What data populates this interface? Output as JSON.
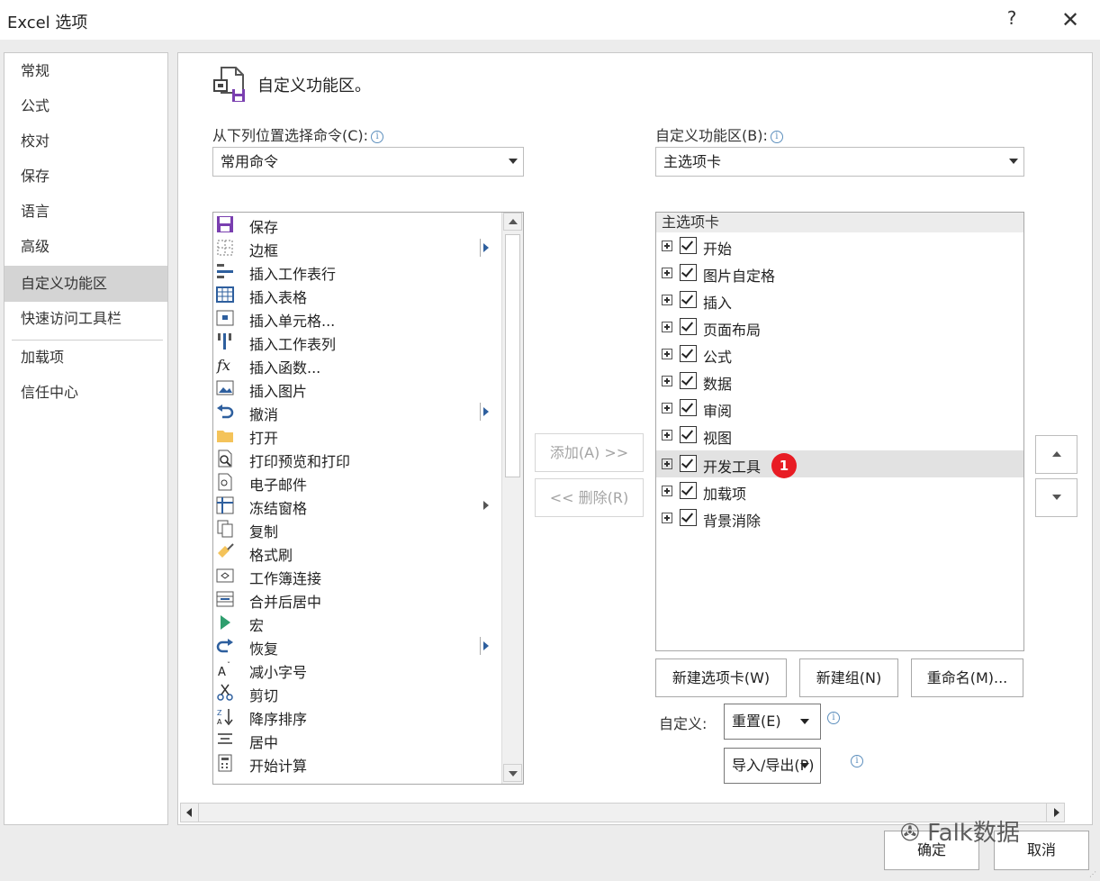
{
  "window": {
    "title": "Excel 选项",
    "help": "?",
    "close": "✕"
  },
  "nav": {
    "items": [
      {
        "label": "常规"
      },
      {
        "label": "公式"
      },
      {
        "label": "校对"
      },
      {
        "label": "保存"
      },
      {
        "label": "语言"
      },
      {
        "label": "高级"
      },
      {
        "label": "自定义功能区"
      },
      {
        "label": "快速访问工具栏"
      },
      {
        "label": "加载项"
      },
      {
        "label": "信任中心"
      }
    ],
    "selected": "自定义功能区"
  },
  "main": {
    "heading": "自定义功能区。",
    "choose_label": "从下列位置选择命令(C):",
    "choose_value": "常用命令",
    "customize_label": "自定义功能区(B):",
    "customize_value": "主选项卡",
    "commands": [
      {
        "label": "保存",
        "icon": "save-icon",
        "submenu": false
      },
      {
        "label": "边框",
        "icon": "border-icon",
        "submenu": true
      },
      {
        "label": "插入工作表行",
        "icon": "insert-rows-icon",
        "submenu": false
      },
      {
        "label": "插入表格",
        "icon": "insert-table-icon",
        "submenu": false
      },
      {
        "label": "插入单元格...",
        "icon": "insert-cells-icon",
        "submenu": false
      },
      {
        "label": "插入工作表列",
        "icon": "insert-columns-icon",
        "submenu": false
      },
      {
        "label": "插入函数...",
        "icon": "function-icon",
        "submenu": false
      },
      {
        "label": "插入图片",
        "icon": "picture-icon",
        "submenu": false
      },
      {
        "label": "撤消",
        "icon": "undo-icon",
        "submenu": true
      },
      {
        "label": "打开",
        "icon": "folder-icon",
        "submenu": false
      },
      {
        "label": "打印预览和打印",
        "icon": "print-preview-icon",
        "submenu": false
      },
      {
        "label": "电子邮件",
        "icon": "email-icon",
        "submenu": false
      },
      {
        "label": "冻结窗格",
        "icon": "freeze-panes-icon",
        "submenu": true
      },
      {
        "label": "复制",
        "icon": "copy-icon",
        "submenu": false
      },
      {
        "label": "格式刷",
        "icon": "format-painter-icon",
        "submenu": false
      },
      {
        "label": "工作簿连接",
        "icon": "connections-icon",
        "submenu": false
      },
      {
        "label": "合并后居中",
        "icon": "merge-center-icon",
        "submenu": false
      },
      {
        "label": "宏",
        "icon": "macro-icon",
        "submenu": false
      },
      {
        "label": "恢复",
        "icon": "redo-icon",
        "submenu": true
      },
      {
        "label": "减小字号",
        "icon": "decrease-font-icon",
        "submenu": false
      },
      {
        "label": "剪切",
        "icon": "scissors-icon",
        "submenu": false
      },
      {
        "label": "降序排序",
        "icon": "sort-desc-icon",
        "submenu": false
      },
      {
        "label": "居中",
        "icon": "align-center-icon",
        "submenu": false
      },
      {
        "label": "开始计算",
        "icon": "calculator-icon",
        "submenu": false
      }
    ],
    "add_button": "添加(A) >>",
    "remove_button": "<< 删除(R)",
    "tree_header": "主选项卡",
    "tabs": [
      {
        "label": "开始",
        "checked": true
      },
      {
        "label": "图片自定格",
        "checked": true
      },
      {
        "label": "插入",
        "checked": true
      },
      {
        "label": "页面布局",
        "checked": true
      },
      {
        "label": "公式",
        "checked": true
      },
      {
        "label": "数据",
        "checked": true
      },
      {
        "label": "审阅",
        "checked": true
      },
      {
        "label": "视图",
        "checked": true
      },
      {
        "label": "开发工具",
        "checked": true
      },
      {
        "label": "加载项",
        "checked": true
      },
      {
        "label": "背景消除",
        "checked": true
      }
    ],
    "selected_tab": "开发工具",
    "step_badge": "1",
    "new_tab_button": "新建选项卡(W)",
    "new_group_button": "新建组(N)",
    "rename_button": "重命名(M)...",
    "customizations_label": "自定义:",
    "reset_button": "重置(E)",
    "import_export_button": "导入/导出(P)"
  },
  "footer": {
    "ok": "确定",
    "cancel": "取消",
    "watermark": "Falk数据"
  },
  "colors": {
    "badge": "#e81c24",
    "selected_nav": "#d4d4d4",
    "accent": "#2e5f9e"
  }
}
